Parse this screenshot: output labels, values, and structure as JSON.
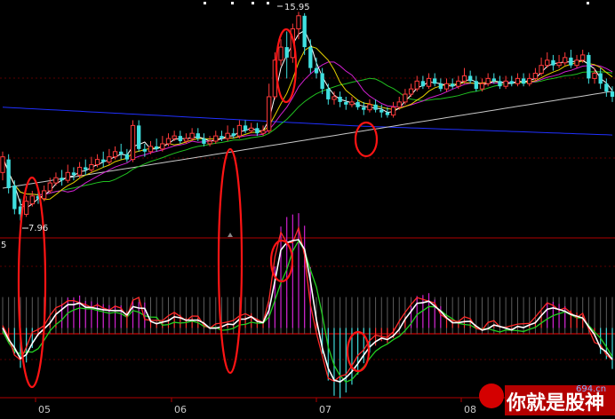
{
  "chart_data": [
    {
      "type": "candlestick",
      "panel": "price",
      "labels": {
        "high": "15.95",
        "low": "7.96"
      },
      "x_ticks": [
        "05",
        "06",
        "07",
        "08"
      ],
      "colors": {
        "up": "#ff3b3b",
        "down": "#3fe0e0",
        "ma5": "#ffffff",
        "ma10": "#e6d200",
        "ma20": "#d020d0",
        "ma30": "#20c020",
        "ma60": "#c8c8c8",
        "ma120": "#2030ff"
      },
      "candles": [
        [
          9.8,
          10.4,
          10.6,
          9.5
        ],
        [
          10.3,
          9.2,
          10.5,
          9.0
        ],
        [
          9.3,
          8.4,
          9.5,
          8.2
        ],
        [
          8.5,
          8.2,
          8.8,
          7.96
        ],
        [
          8.2,
          8.7,
          8.9,
          8.1
        ],
        [
          8.6,
          8.9,
          9.1,
          8.5
        ],
        [
          8.9,
          8.8,
          9.2,
          8.6
        ],
        [
          8.8,
          9.1,
          9.3,
          8.7
        ],
        [
          9.1,
          9.4,
          9.6,
          9.0
        ],
        [
          9.4,
          9.6,
          9.8,
          9.3
        ],
        [
          9.6,
          9.5,
          9.9,
          9.3
        ],
        [
          9.5,
          9.8,
          10.1,
          9.4
        ],
        [
          9.8,
          9.7,
          10.0,
          9.5
        ],
        [
          9.7,
          10.0,
          10.2,
          9.6
        ],
        [
          10.0,
          9.9,
          10.3,
          9.7
        ],
        [
          9.9,
          10.1,
          10.4,
          9.8
        ],
        [
          10.1,
          10.3,
          10.5,
          10.0
        ],
        [
          10.3,
          10.2,
          10.6,
          10.0
        ],
        [
          10.2,
          10.4,
          10.7,
          10.1
        ],
        [
          10.4,
          10.6,
          10.8,
          10.3
        ],
        [
          10.6,
          10.5,
          10.9,
          10.3
        ],
        [
          10.5,
          10.3,
          10.7,
          10.2
        ],
        [
          10.3,
          11.6,
          11.8,
          10.2
        ],
        [
          11.6,
          10.7,
          11.8,
          10.6
        ],
        [
          10.7,
          10.6,
          10.9,
          10.4
        ],
        [
          10.6,
          10.8,
          11.0,
          10.5
        ],
        [
          10.8,
          10.7,
          11.1,
          10.6
        ],
        [
          10.7,
          10.9,
          11.2,
          10.6
        ],
        [
          10.9,
          11.1,
          11.3,
          10.8
        ],
        [
          11.1,
          11.2,
          11.4,
          11.0
        ],
        [
          11.2,
          11.0,
          11.4,
          10.9
        ],
        [
          11.0,
          11.1,
          11.3,
          10.9
        ],
        [
          11.1,
          11.3,
          11.5,
          11.0
        ],
        [
          11.3,
          11.1,
          11.5,
          11.0
        ],
        [
          11.1,
          10.9,
          11.3,
          10.8
        ],
        [
          10.9,
          11.0,
          11.2,
          10.8
        ],
        [
          11.0,
          11.2,
          11.4,
          10.9
        ],
        [
          11.2,
          11.1,
          11.4,
          11.0
        ],
        [
          11.1,
          11.3,
          11.6,
          11.0
        ],
        [
          11.3,
          11.2,
          11.5,
          11.1
        ],
        [
          11.2,
          11.6,
          11.8,
          11.1
        ],
        [
          11.6,
          11.4,
          11.8,
          11.3
        ],
        [
          11.4,
          11.5,
          11.7,
          11.3
        ],
        [
          11.5,
          11.3,
          11.7,
          11.2
        ],
        [
          11.3,
          11.4,
          11.6,
          11.2
        ],
        [
          11.4,
          12.7,
          13.2,
          11.3
        ],
        [
          12.7,
          14.1,
          14.4,
          12.6
        ],
        [
          14.1,
          14.6,
          14.9,
          13.9
        ],
        [
          14.6,
          14.2,
          15.2,
          13.4
        ],
        [
          14.2,
          15.3,
          15.5,
          14.0
        ],
        [
          15.3,
          15.8,
          15.95,
          14.9
        ],
        [
          15.8,
          14.6,
          15.9,
          14.3
        ],
        [
          14.6,
          13.8,
          14.9,
          13.6
        ],
        [
          13.8,
          13.6,
          14.2,
          13.4
        ],
        [
          13.6,
          13.0,
          13.8,
          12.8
        ],
        [
          13.0,
          12.6,
          13.2,
          12.4
        ],
        [
          12.6,
          12.7,
          12.9,
          12.4
        ],
        [
          12.7,
          12.5,
          12.9,
          12.3
        ],
        [
          12.5,
          12.4,
          12.7,
          12.2
        ],
        [
          12.4,
          12.5,
          12.7,
          12.3
        ],
        [
          12.5,
          12.3,
          12.6,
          12.2
        ],
        [
          12.3,
          12.2,
          12.5,
          12.0
        ],
        [
          12.2,
          12.4,
          12.6,
          12.1
        ],
        [
          12.4,
          12.2,
          12.6,
          12.1
        ],
        [
          12.2,
          12.1,
          12.4,
          11.9
        ],
        [
          12.1,
          12.0,
          12.3,
          11.9
        ],
        [
          12.0,
          12.3,
          12.5,
          11.9
        ],
        [
          12.3,
          12.5,
          12.7,
          12.2
        ],
        [
          12.5,
          12.8,
          13.0,
          12.4
        ],
        [
          12.8,
          13.0,
          13.2,
          12.7
        ],
        [
          13.0,
          13.3,
          13.5,
          12.9
        ],
        [
          13.3,
          13.1,
          13.5,
          13.0
        ],
        [
          13.1,
          13.4,
          13.6,
          13.0
        ],
        [
          13.4,
          13.2,
          13.6,
          13.1
        ],
        [
          13.2,
          13.0,
          13.4,
          12.9
        ],
        [
          13.0,
          13.2,
          13.4,
          12.9
        ],
        [
          13.2,
          13.1,
          13.4,
          13.0
        ],
        [
          13.1,
          13.3,
          13.5,
          13.0
        ],
        [
          13.3,
          13.5,
          13.8,
          13.2
        ],
        [
          13.5,
          13.3,
          13.7,
          13.2
        ],
        [
          13.3,
          13.0,
          13.5,
          12.9
        ],
        [
          13.0,
          13.2,
          13.4,
          12.9
        ],
        [
          13.2,
          13.4,
          13.6,
          13.1
        ],
        [
          13.4,
          13.3,
          13.6,
          13.2
        ],
        [
          13.3,
          13.1,
          13.5,
          13.0
        ],
        [
          13.1,
          13.3,
          13.5,
          13.0
        ],
        [
          13.3,
          13.2,
          13.5,
          13.1
        ],
        [
          13.2,
          13.4,
          13.6,
          13.1
        ],
        [
          13.4,
          13.2,
          13.6,
          13.1
        ],
        [
          13.2,
          13.4,
          13.6,
          13.1
        ],
        [
          13.4,
          13.6,
          13.8,
          13.3
        ],
        [
          13.6,
          13.9,
          14.2,
          13.5
        ],
        [
          13.9,
          14.1,
          14.4,
          13.8
        ],
        [
          14.1,
          13.9,
          14.3,
          13.7
        ],
        [
          13.9,
          14.0,
          14.3,
          13.8
        ],
        [
          14.0,
          14.2,
          14.4,
          13.9
        ],
        [
          14.2,
          13.9,
          14.5,
          13.8
        ],
        [
          13.9,
          14.1,
          14.3,
          13.8
        ],
        [
          14.1,
          14.3,
          14.5,
          14.0
        ],
        [
          14.3,
          13.4,
          14.4,
          13.2
        ],
        [
          13.4,
          13.6,
          13.8,
          13.2
        ],
        [
          13.6,
          13.2,
          13.8,
          13.0
        ],
        [
          13.2,
          12.9,
          13.4,
          12.7
        ],
        [
          12.9,
          12.7,
          13.1,
          12.5
        ]
      ],
      "y_range": [
        7.5,
        16.2
      ]
    },
    {
      "type": "line+histogram",
      "panel": "indicator",
      "label": "5",
      "colors": {
        "white_line": "#ffffff",
        "red_line": "#ff2a2a",
        "green_line": "#22d022",
        "magenta_bars": "#d020d0",
        "cyan_bars": "#3fd8d8",
        "red_bars": "#ff3030"
      },
      "y_range": [
        -2.2,
        2.8
      ]
    }
  ],
  "watermark": {
    "text": "你就是股神",
    "site": "694.cn"
  }
}
